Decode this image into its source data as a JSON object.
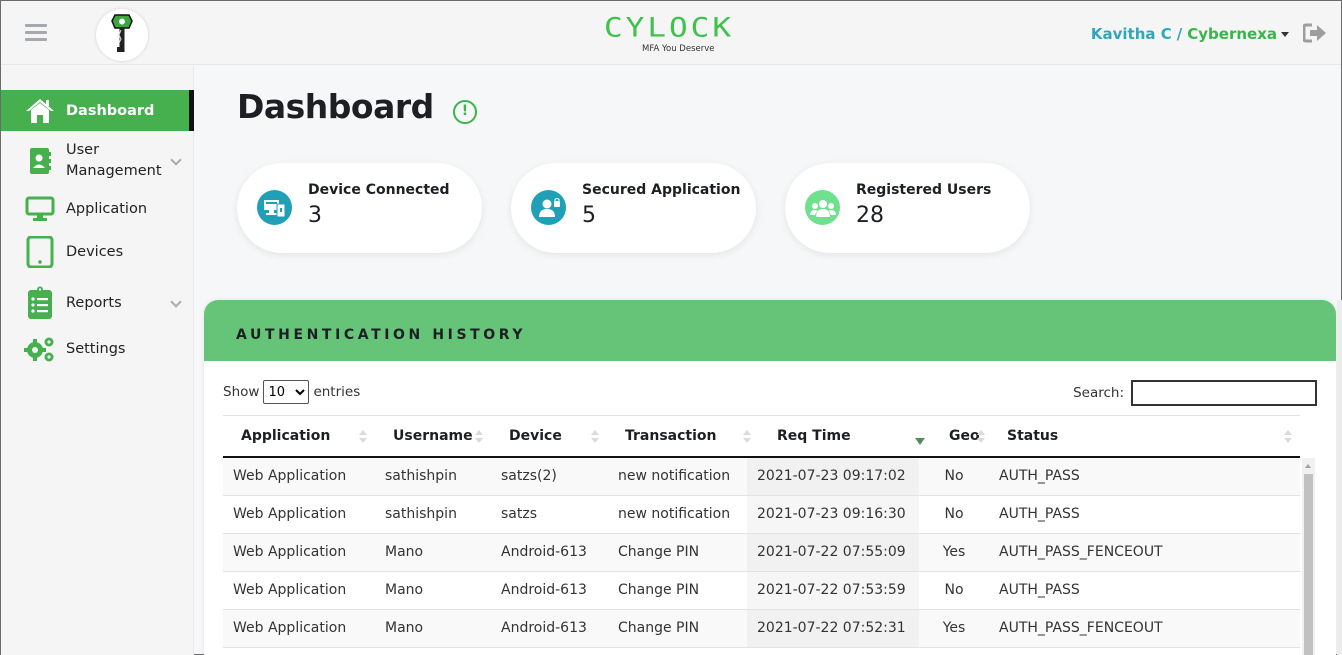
{
  "header": {
    "brand_name": "CYLOCK",
    "brand_tagline": "MFA You Deserve",
    "user_name": "Kavitha C",
    "separator": "/",
    "organization": "Cybernexa"
  },
  "sidebar": {
    "items": [
      {
        "label": "Dashboard",
        "icon": "home-icon",
        "active": true
      },
      {
        "label": "User Management",
        "icon": "contact-book-icon",
        "expandable": true
      },
      {
        "label": "Application",
        "icon": "monitor-icon"
      },
      {
        "label": "Devices",
        "icon": "tablet-icon"
      },
      {
        "label": "Reports",
        "icon": "clipboard-list-icon",
        "expandable": true
      },
      {
        "label": "Settings",
        "icon": "gears-icon"
      }
    ]
  },
  "page": {
    "title": "Dashboard",
    "info_glyph": "!"
  },
  "stats": [
    {
      "label": "Device Connected",
      "value": "3",
      "icon": "devices-icon",
      "color": "#1fa0b6"
    },
    {
      "label": "Secured Application",
      "value": "5",
      "icon": "user-lock-icon",
      "color": "#1fa0b6"
    },
    {
      "label": "Registered Users",
      "value": "28",
      "icon": "users-icon",
      "color": "#6fe08f"
    }
  ],
  "auth_history": {
    "title": "AUTHENTICATION HISTORY",
    "show_label": "Show",
    "entries_label": "entries",
    "page_size": "10",
    "search_label": "Search:",
    "search_value": "",
    "columns": [
      "Application",
      "Username",
      "Device",
      "Transaction",
      "Req Time",
      "Geo",
      "Status"
    ],
    "sorted_column": "Req Time",
    "sort_direction": "desc",
    "rows": [
      [
        "Web Application",
        "sathishpin",
        "satzs(2)",
        "new notification",
        "2021-07-23 09:17:02",
        "No",
        "AUTH_PASS"
      ],
      [
        "Web Application",
        "sathishpin",
        "satzs",
        "new notification",
        "2021-07-23 09:16:30",
        "No",
        "AUTH_PASS"
      ],
      [
        "Web Application",
        "Mano",
        "Android-613",
        "Change PIN",
        "2021-07-22 07:55:09",
        "Yes",
        "AUTH_PASS_FENCEOUT"
      ],
      [
        "Web Application",
        "Mano",
        "Android-613",
        "Change PIN",
        "2021-07-22 07:53:59",
        "No",
        "AUTH_PASS"
      ],
      [
        "Web Application",
        "Mano",
        "Android-613",
        "Change PIN",
        "2021-07-22 07:52:31",
        "Yes",
        "AUTH_PASS_FENCEOUT"
      ]
    ]
  },
  "colors": {
    "accent_green": "#46b04e",
    "panel_green": "#66c479",
    "teal": "#1fa0b6"
  }
}
